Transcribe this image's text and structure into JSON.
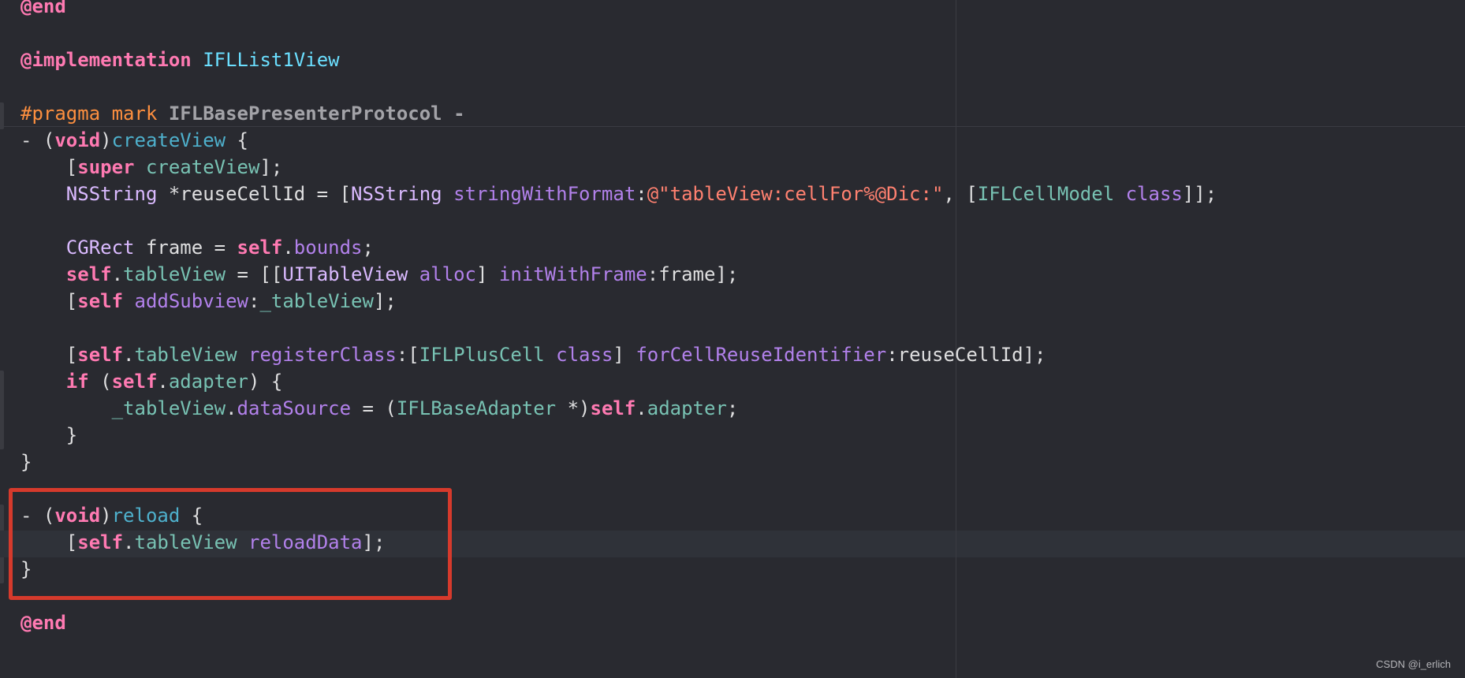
{
  "editor": {
    "lines": [
      [
        {
          "t": "@end",
          "c": "kw"
        }
      ],
      [],
      [
        {
          "t": "@implementation",
          "c": "kw"
        },
        {
          "t": " ",
          "c": "plain"
        },
        {
          "t": "IFLList1View",
          "c": "cls"
        }
      ],
      [],
      [
        {
          "t": "#pragma mark ",
          "c": "pp"
        },
        {
          "t": "IFLBasePresenterProtocol -",
          "c": "pragma"
        }
      ],
      [
        {
          "t": "- (",
          "c": "plain"
        },
        {
          "t": "void",
          "c": "kw"
        },
        {
          "t": ")",
          "c": "plain"
        },
        {
          "t": "createView",
          "c": "decl"
        },
        {
          "t": " {",
          "c": "plain"
        }
      ],
      [
        {
          "t": "    [",
          "c": "plain"
        },
        {
          "t": "super",
          "c": "kw"
        },
        {
          "t": " ",
          "c": "plain"
        },
        {
          "t": "createView",
          "c": "prop"
        },
        {
          "t": "];",
          "c": "plain"
        }
      ],
      [
        {
          "t": "    ",
          "c": "plain"
        },
        {
          "t": "NSString",
          "c": "typ"
        },
        {
          "t": " *reuseCellId = [",
          "c": "plain"
        },
        {
          "t": "NSString",
          "c": "typ"
        },
        {
          "t": " ",
          "c": "plain"
        },
        {
          "t": "stringWithFormat",
          "c": "meth"
        },
        {
          "t": ":",
          "c": "plain"
        },
        {
          "t": "@\"tableView:cellFor%@Dic:\"",
          "c": "str"
        },
        {
          "t": ", [",
          "c": "plain"
        },
        {
          "t": "IFLCellModel",
          "c": "prop"
        },
        {
          "t": " ",
          "c": "plain"
        },
        {
          "t": "class",
          "c": "meth"
        },
        {
          "t": "]];",
          "c": "plain"
        }
      ],
      [],
      [
        {
          "t": "    ",
          "c": "plain"
        },
        {
          "t": "CGRect",
          "c": "typ"
        },
        {
          "t": " frame = ",
          "c": "plain"
        },
        {
          "t": "self",
          "c": "kw"
        },
        {
          "t": ".",
          "c": "plain"
        },
        {
          "t": "bounds",
          "c": "meth"
        },
        {
          "t": ";",
          "c": "plain"
        }
      ],
      [
        {
          "t": "    ",
          "c": "plain"
        },
        {
          "t": "self",
          "c": "kw"
        },
        {
          "t": ".",
          "c": "plain"
        },
        {
          "t": "tableView",
          "c": "prop"
        },
        {
          "t": " = [[",
          "c": "plain"
        },
        {
          "t": "UITableView",
          "c": "typ"
        },
        {
          "t": " ",
          "c": "plain"
        },
        {
          "t": "alloc",
          "c": "meth"
        },
        {
          "t": "] ",
          "c": "plain"
        },
        {
          "t": "initWithFrame",
          "c": "meth"
        },
        {
          "t": ":frame];",
          "c": "plain"
        }
      ],
      [
        {
          "t": "    [",
          "c": "plain"
        },
        {
          "t": "self",
          "c": "kw"
        },
        {
          "t": " ",
          "c": "plain"
        },
        {
          "t": "addSubview",
          "c": "meth"
        },
        {
          "t": ":",
          "c": "plain"
        },
        {
          "t": "_tableView",
          "c": "prop"
        },
        {
          "t": "];",
          "c": "plain"
        }
      ],
      [],
      [
        {
          "t": "    [",
          "c": "plain"
        },
        {
          "t": "self",
          "c": "kw"
        },
        {
          "t": ".",
          "c": "plain"
        },
        {
          "t": "tableView",
          "c": "prop"
        },
        {
          "t": " ",
          "c": "plain"
        },
        {
          "t": "registerClass",
          "c": "meth"
        },
        {
          "t": ":[",
          "c": "plain"
        },
        {
          "t": "IFLPlusCell",
          "c": "prop"
        },
        {
          "t": " ",
          "c": "plain"
        },
        {
          "t": "class",
          "c": "meth"
        },
        {
          "t": "] ",
          "c": "plain"
        },
        {
          "t": "forCellReuseIdentifier",
          "c": "meth"
        },
        {
          "t": ":reuseCellId];",
          "c": "plain"
        }
      ],
      [
        {
          "t": "    ",
          "c": "plain"
        },
        {
          "t": "if",
          "c": "kw"
        },
        {
          "t": " (",
          "c": "plain"
        },
        {
          "t": "self",
          "c": "kw"
        },
        {
          "t": ".",
          "c": "plain"
        },
        {
          "t": "adapter",
          "c": "prop"
        },
        {
          "t": ") {",
          "c": "plain"
        }
      ],
      [
        {
          "t": "        ",
          "c": "plain"
        },
        {
          "t": "_tableView",
          "c": "prop"
        },
        {
          "t": ".",
          "c": "plain"
        },
        {
          "t": "dataSource",
          "c": "meth"
        },
        {
          "t": " = (",
          "c": "plain"
        },
        {
          "t": "IFLBaseAdapter",
          "c": "prop"
        },
        {
          "t": " *)",
          "c": "plain"
        },
        {
          "t": "self",
          "c": "kw"
        },
        {
          "t": ".",
          "c": "plain"
        },
        {
          "t": "adapter",
          "c": "prop"
        },
        {
          "t": ";",
          "c": "plain"
        }
      ],
      [
        {
          "t": "    }",
          "c": "plain"
        }
      ],
      [
        {
          "t": "}",
          "c": "plain"
        }
      ],
      [],
      [
        {
          "t": "- (",
          "c": "plain"
        },
        {
          "t": "void",
          "c": "kw"
        },
        {
          "t": ")",
          "c": "plain"
        },
        {
          "t": "reload",
          "c": "decl"
        },
        {
          "t": " {",
          "c": "plain"
        }
      ],
      [
        {
          "t": "    [",
          "c": "plain"
        },
        {
          "t": "self",
          "c": "kw"
        },
        {
          "t": ".",
          "c": "plain"
        },
        {
          "t": "tableView",
          "c": "prop"
        },
        {
          "t": " ",
          "c": "plain"
        },
        {
          "t": "reloadData",
          "c": "meth"
        },
        {
          "t": "];",
          "c": "plain"
        }
      ],
      [
        {
          "t": "}",
          "c": "plain"
        }
      ],
      [],
      [
        {
          "t": "@end",
          "c": "kw"
        }
      ]
    ]
  },
  "watermark": {
    "text": "CSDN @i_erlich"
  },
  "colors": {
    "background": "#292a30",
    "keyword": "#ff7ab2",
    "preprocessor": "#fd8f3f",
    "class_name": "#6bdfff",
    "type": "#dabaff",
    "method": "#b281eb",
    "property": "#78c2b3",
    "declaration": "#4eb0cc",
    "string": "#ff8170",
    "plain_text": "#dfdfe0",
    "highlight_box": "#d63a2c"
  }
}
